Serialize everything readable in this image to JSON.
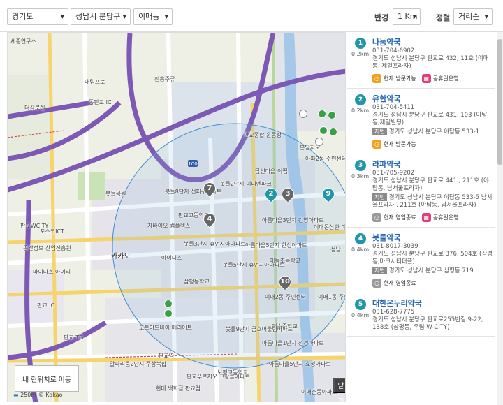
{
  "filters": {
    "province": "경기도",
    "city": "성남시 분당구",
    "district": "이매동",
    "radius_label": "반경",
    "radius": "1 Km",
    "sort_label": "정렬",
    "sort": "거리순"
  },
  "map": {
    "labels": [
      "세종연구소",
      "진흥주류",
      "대림프로",
      "더감로실",
      "더감",
      "라판",
      "동판교 IC",
      "판교종합 운동장",
      "분당지오",
      "아파2동 주민센터",
      "복지사",
      "탑선마을 이펍",
      "복지센터",
      "봇들공원",
      "봇들8단지 선피주아파트",
      "봇들2단지 이디엔파크",
      "판교고등학교",
      "차바이오 컴플렉스",
      "봇들3단지 휴먼시아아파트",
      "아름마을3단지 건영아파트",
      "이매동삼환 아파트",
      "아름마을5단지 한성아파트",
      "카카오",
      "판교WCITY",
      "포스코ICT",
      "공간정보 산업진흥원",
      "마이다스 아이티",
      "아이디스",
      "봇들5단지 휴먼시아아파트",
      "삼평동학교",
      "매동초등학교",
      "이매1동 주민센터",
      "이매2동 주민센터",
      "매송중학교",
      "코트야드바이 메리어트",
      "판교 IC",
      "판교 TG",
      "판교역",
      "판교역",
      "알파리움2단지 주상복합",
      "현대 백화점 판교점",
      "봇들9단지 금호어울림아파트",
      "판교푸르지오 그랑블아파트",
      "보평고등학교",
      "아름마을1단지 선경아파트",
      "아름마을5단지 효성아파트",
      "이매촌동아파트",
      "성남",
      "kakao",
      "아름마을한신 아파트",
      "삼평중학교",
      "이매중학교",
      "수내동 삼성"
    ],
    "locate_button": "내 현위치로 이동",
    "close_button": "닫기",
    "scale": "250m",
    "copyright": "© Kakao"
  },
  "results": [
    {
      "num": "1",
      "name": "나눔약국",
      "dist": "0.2km",
      "phone": "031-704-6902",
      "address": "경기도 성남시 분당구 판교로 432, 11호 (이매동, 제일프라자)",
      "jibun": "",
      "badges": [
        {
          "text": "현재 방문가능",
          "icon": "clock-icon",
          "color": "orange"
        },
        {
          "text": "공휴일운영",
          "icon": "calendar-icon",
          "color": "pink"
        }
      ]
    },
    {
      "num": "2",
      "name": "유한약국",
      "dist": "0.2km",
      "phone": "031-704-5411",
      "address": "경기도 성남시 분당구 판교로 431, 103 (야탑동,제일빌딩)",
      "jibun": "경기도 성남시 분당구 야탑동 533-1",
      "badges": [
        {
          "text": "현재 방문가능",
          "icon": "clock-icon",
          "color": "orange"
        }
      ]
    },
    {
      "num": "3",
      "name": "라파약국",
      "dist": "0.3km",
      "phone": "031-705-9202",
      "address": "경기도 성남시 분당구 판교로 441 , 211호 (야탑동, 남서울프라자)",
      "jibun": "경기도 성남시 분당구 야탑동 533-5 남서울프라자 , 211호 (야탑동, 남서울프라자)",
      "badges": [
        {
          "text": "현재 영업종료",
          "icon": "clock-icon",
          "color": "gray"
        },
        {
          "text": "공휴일운영",
          "icon": "calendar-icon",
          "color": "pink"
        }
      ]
    },
    {
      "num": "4",
      "name": "봇들약국",
      "dist": "0.4km",
      "phone": "031-8017-3039",
      "address": "경기도 성남시 분당구 판교로 376, 504호 (삼평동,마크시티퍼플)",
      "jibun": "경기도 성남시 분당구 삼평동 719",
      "badges": [
        {
          "text": "현재 영업종료",
          "icon": "clock-icon",
          "color": "gray"
        }
      ]
    },
    {
      "num": "5",
      "name": "대한온누리약국",
      "dist": "0.4km",
      "phone": "031-628-7775",
      "address": "경기도 성남시 분당구 판교로255번길 9-22, 138호 (삼평동, 우림 W-CITY)",
      "jibun": "",
      "badges": []
    }
  ],
  "jibun_tag": "지번",
  "colors": {
    "accent": "#1f97a8",
    "link": "#2567b0",
    "orange": "#f0a019",
    "pink": "#e0407a",
    "gray": "#999999"
  }
}
